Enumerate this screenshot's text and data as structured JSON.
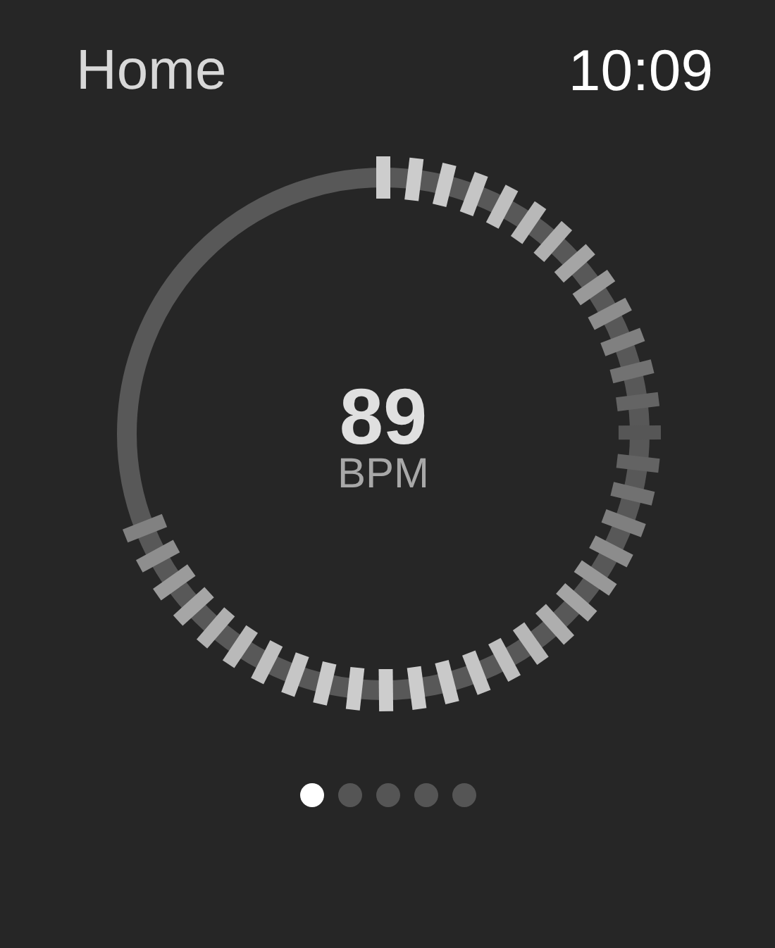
{
  "header": {
    "title": "Home",
    "time": "10:09"
  },
  "heart_rate": {
    "value": "89",
    "unit": "BPM"
  },
  "pages": [
    {
      "selected": true
    },
    {
      "selected": false
    },
    {
      "selected": false
    },
    {
      "selected": false
    },
    {
      "selected": false
    }
  ]
}
